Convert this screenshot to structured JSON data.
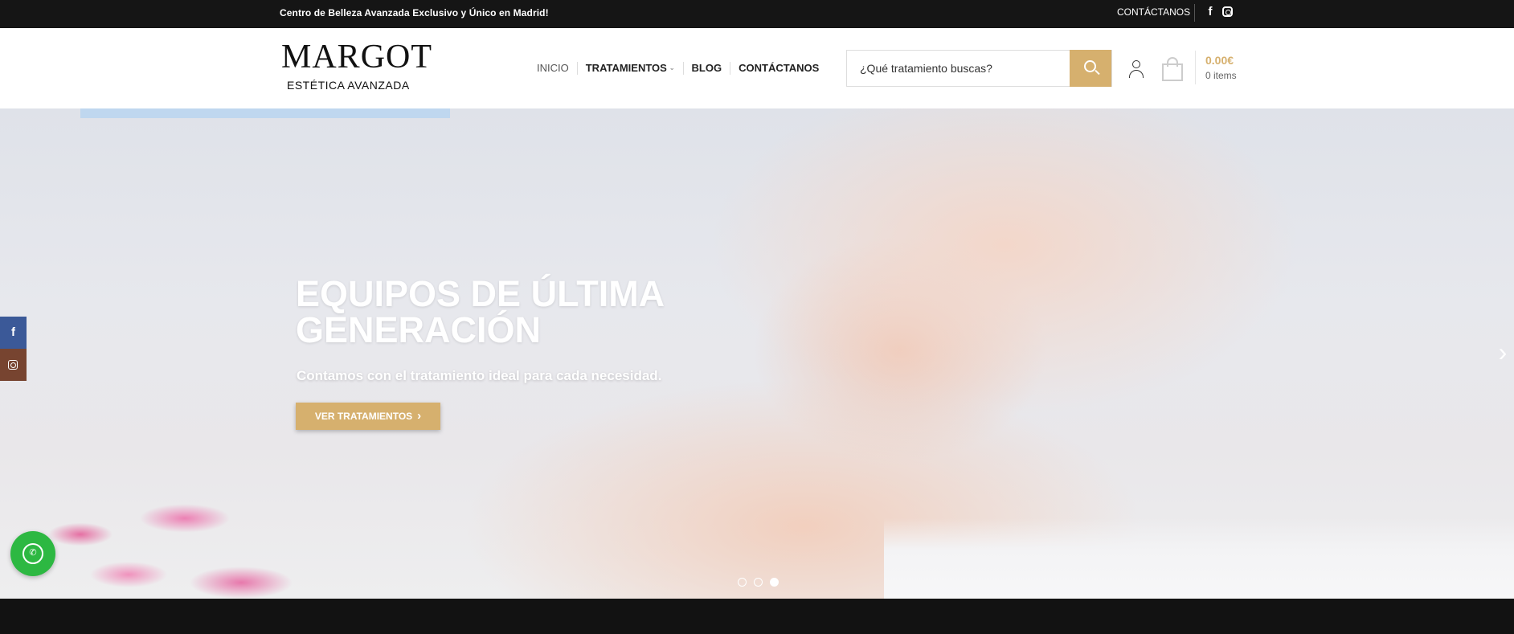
{
  "topbar": {
    "promo": "Centro de Belleza Avanzada Exclusivo y Único en Madrid!",
    "contact_label": "CONTÁCTANOS",
    "icons": [
      "facebook-icon",
      "instagram-icon"
    ]
  },
  "header": {
    "logo_main": "MARGOT",
    "logo_sub": "ESTÉTICA AVANZADA",
    "nav": [
      {
        "label": "INICIO"
      },
      {
        "label": "TRATAMIENTOS",
        "has_dropdown": true
      },
      {
        "label": "BLOG"
      },
      {
        "label": "CONTÁCTANOS"
      }
    ],
    "search": {
      "placeholder": "¿Qué tratamiento buscas?"
    },
    "cart": {
      "total": "0.00€",
      "count": "0 items"
    }
  },
  "hero": {
    "title": "EQUIPOS DE ÚLTIMA GENERACIÓN",
    "subtitle": "Contamos con el tratamiento ideal para cada necesidad.",
    "cta_label": "VER TRATAMIENTOS",
    "slides": 3,
    "active_slide": 3
  },
  "colors": {
    "accent": "#d6b06e",
    "topbar_bg": "#151515",
    "facebook": "#3b5998",
    "instagram": "#774430",
    "whatsapp": "#2db842"
  }
}
